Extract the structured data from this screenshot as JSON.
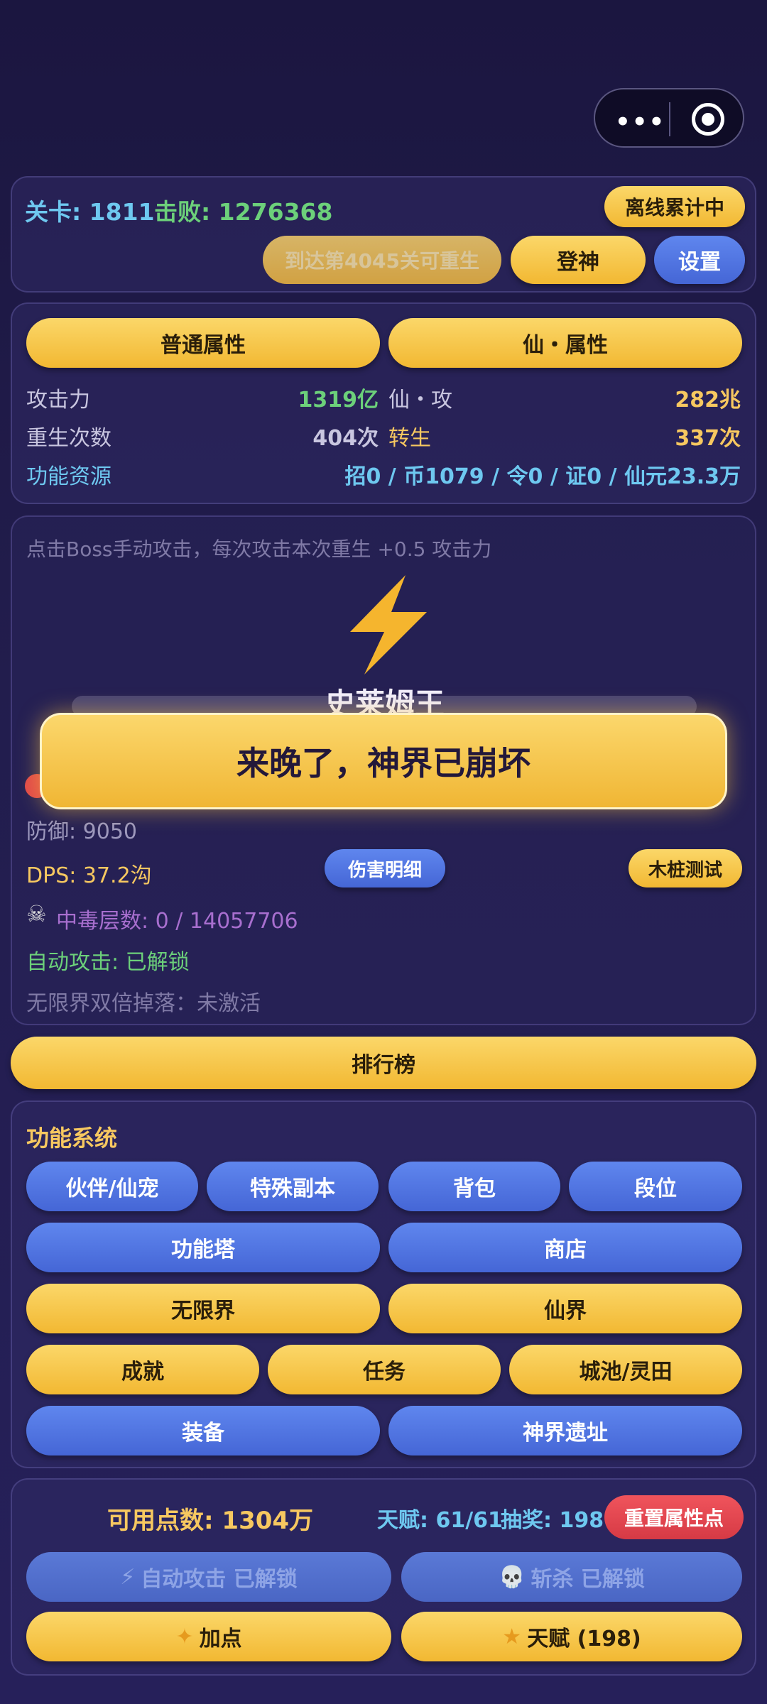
{
  "header": {
    "stage_label": "关卡: 1811",
    "defeated_label": "击败: 1276368",
    "offline_button": "离线累计中",
    "rebirth_hint_button": "到达第4045关可重生",
    "ascend_button": "登神",
    "settings_button": "设置"
  },
  "attributes": {
    "tab_normal": "普通属性",
    "tab_immortal": "仙・属性",
    "attack_label": "攻击力",
    "attack_value": "1319亿",
    "immortal_attack_label": "仙・攻",
    "immortal_attack_value": "282兆",
    "rebirth_count_label": "重生次数",
    "rebirth_count_value": "404次",
    "reincarnation_label": "转生",
    "reincarnation_value": "337次",
    "resources_label": "功能资源",
    "resources_value": "招0 / 币1079 / 令0 / 证0 / 仙元23.3万"
  },
  "battle": {
    "hint": "点击Boss手动攻击，每次攻击本次重生 +0.5 攻击力",
    "boss_icon": "lightning-icon",
    "boss_name": "史莱姆王",
    "collapsed_banner": "来晚了，神界已崩坏",
    "defense": "防御: 9050",
    "dps": "DPS: 37.2沟",
    "damage_detail_button": "伤害明细",
    "dummy_test_button": "木桩测试",
    "poison": "中毒层数: 0 / 14057706",
    "poison_icon": "skull-crossbones-icon",
    "auto_attack": "自动攻击: 已解锁",
    "double_drop": "无限界双倍掉落：未激活"
  },
  "leaderboard_button": "排行榜",
  "features": {
    "title": "功能系统",
    "partner": "伙伴/仙宠",
    "special_dungeon": "特殊副本",
    "backpack": "背包",
    "rank": "段位",
    "tower": "功能塔",
    "shop": "商店",
    "infinite_realm": "无限界",
    "immortal_realm": "仙界",
    "achievements": "成就",
    "quests": "任务",
    "city_field": "城池/灵田",
    "equipment": "装备",
    "divine_ruins": "神界遗址"
  },
  "points": {
    "available": "可用点数: 1304万",
    "talent": "天赋: 61/61",
    "lottery": "抽奖: 198",
    "reset_button": "重置属性点",
    "auto_attack_button": "自动攻击 已解锁",
    "execute_button": "斩杀 已解锁",
    "add_points_button": "加点",
    "talent_button": "天赋 (198)"
  },
  "colors": {
    "accent_yellow": "#f5c03c",
    "accent_blue": "#4f72e0",
    "green_text": "#6cd07a",
    "cyan_text": "#6ec8f0",
    "gold_text": "#f7c860",
    "purple_text": "#a86fcf"
  }
}
